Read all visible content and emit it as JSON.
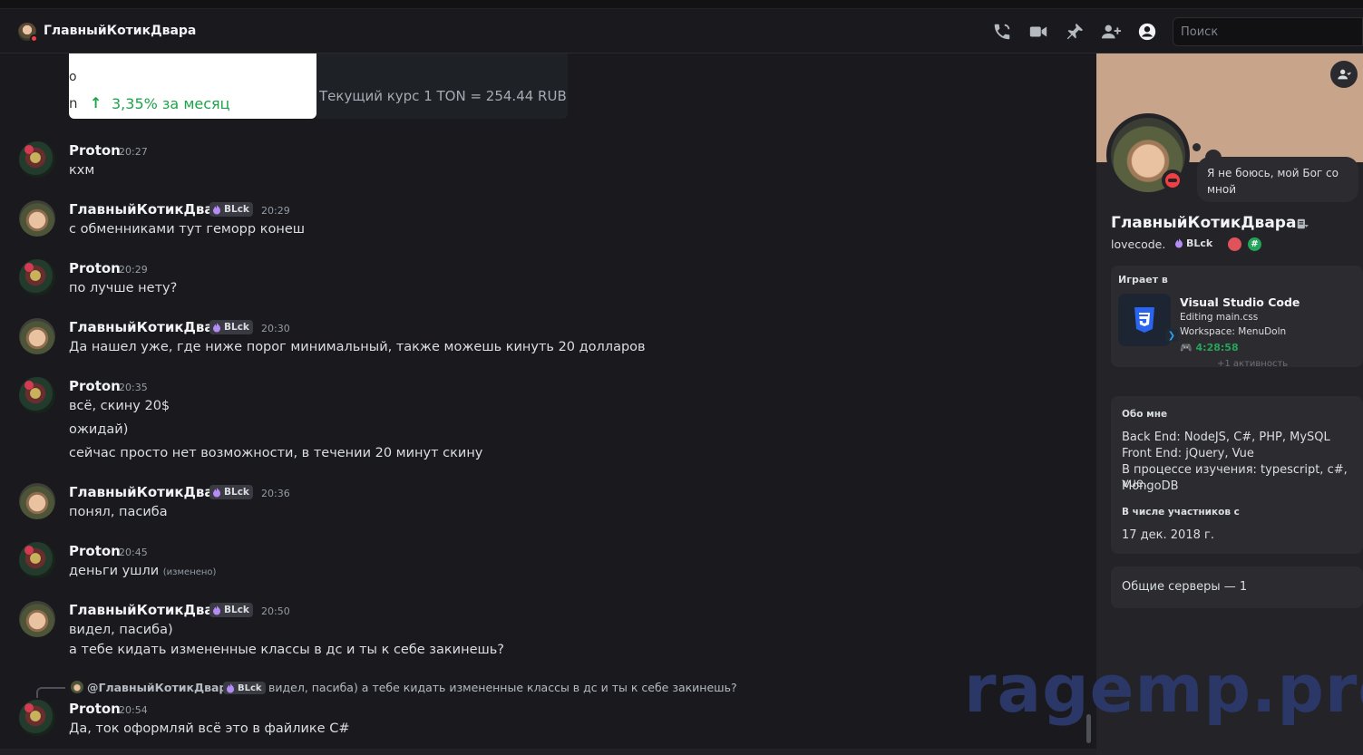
{
  "header": {
    "title": "ГлавныйКотикДвара",
    "search_placeholder": "Поиск",
    "icons": [
      "phone-call-icon",
      "video-camera-icon",
      "pin-icon",
      "add-member-icon",
      "user-profile-icon"
    ]
  },
  "embed": {
    "white_line1": "о",
    "white_line2": "n",
    "arrow": "↑",
    "percent_text": "3,35%  за месяц",
    "rate_text": "Текущий курс  1 TON = 254.44 RUB"
  },
  "tag_label": "BLck",
  "messages": [
    {
      "author": "Proton",
      "time": "20:27",
      "lines": [
        "кхм"
      ]
    },
    {
      "author": "ГлавныйКотикДвара",
      "time": "20:29",
      "lines": [
        "с обменниками тут геморр конеш"
      ]
    },
    {
      "author": "Proton",
      "time": "20:29",
      "lines": [
        "по лучше нету?"
      ]
    },
    {
      "author": "ГлавныйКотикДвара",
      "time": "20:30",
      "lines": [
        "Да нашел уже, где ниже порог минимальный, также можешь кинуть 20 долларов"
      ]
    },
    {
      "author": "Proton",
      "time": "20:35",
      "lines": [
        "всё, скину 20$",
        "ожидай)",
        "сейчас просто нет возможности, в течении 20 минут скину"
      ]
    },
    {
      "author": "ГлавныйКотикДвара",
      "time": "20:36",
      "lines": [
        "понял, пасиба"
      ]
    },
    {
      "author": "Proton",
      "time": "20:45",
      "lines": [
        "деньги ушли"
      ],
      "edited": "(изменено)"
    },
    {
      "author": "ГлавныйКотикДвара",
      "time": "20:50",
      "lines": [
        "видел, пасиба)",
        "а тебе кидать измененные классы в дс и ты к себе закинешь?"
      ]
    },
    {
      "author": "Proton",
      "time": "20:54",
      "lines": [
        "Да, ток оформляй всё это в файлике C#"
      ]
    }
  ],
  "reply": {
    "name": "@ГлавныйКотикДвара",
    "text": "видел, пасиба) а тебе кидать измененные классы в дс и ты к себе закинешь?"
  },
  "watermark": "ragemp.pro",
  "profile": {
    "status_bubble": "Я не боюсь, мой Бог со мной",
    "display_name": "ГлавныйКотикДвара",
    "username": "lovecode.",
    "tag": "BLck",
    "badge_hash": "#",
    "activity": {
      "header": "Играет в",
      "title": "Visual Studio Code",
      "line1": "Editing main.css",
      "line2": "Workspace: MenuDoln",
      "elapsed": "4:28:58",
      "more": "+1 активность"
    },
    "about_header": "Обо мне",
    "about_lines": [
      "Back End: NodeJS, C#, PHP, MySQL",
      "Front End: jQuery, Vue",
      "В процессе изучения: typescript, c#, vue,",
      "MongoDB"
    ],
    "member_header": "В числе участников с",
    "member_since": "17 дек. 2018 г.",
    "servers": "Общие серверы — 1"
  }
}
